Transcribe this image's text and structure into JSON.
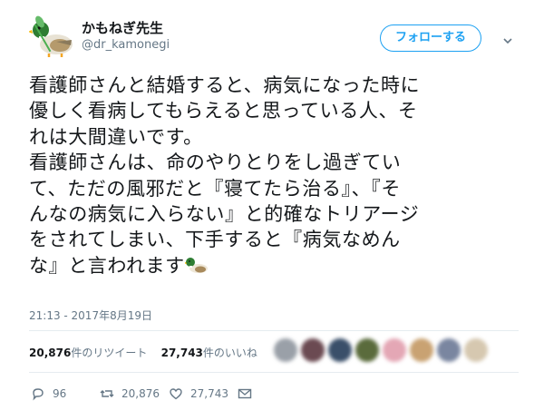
{
  "user": {
    "display_name": "かもねぎ先生",
    "handle": "@dr_kamonegi",
    "avatar_icon": "duck-avatar-icon"
  },
  "header": {
    "follow_label": "フォローする",
    "menu_icon": "chevron-down-icon"
  },
  "tweet": {
    "lines": [
      "看護師さんと結婚すると、病気になった時に",
      "優しく看病してもらえると思っている人、そ",
      "れは大間違いです。",
      "看護師さんは、命のやりとりをし過ぎてい",
      "て、ただの風邪だと『寝てたら治る』、『そ",
      "んなの病気に入らない』と的確なトリアージ",
      "をされてしまい、下手すると『病気なめん",
      "な』と言われます"
    ],
    "emoji_icon": "duck-emoji-icon",
    "timestamp": "21:13 - 2017年8月19日"
  },
  "stats": {
    "retweet_count": "20,876",
    "retweet_label": "件のリツイート",
    "like_count": "27,743",
    "like_label": "件のいいね"
  },
  "actions": {
    "reply_count": "96",
    "retweet_count": "20,876",
    "like_count": "27,743"
  },
  "colors": {
    "accent": "#1da1f2",
    "secondary_text": "#657786",
    "divider": "#e6ecf0"
  }
}
